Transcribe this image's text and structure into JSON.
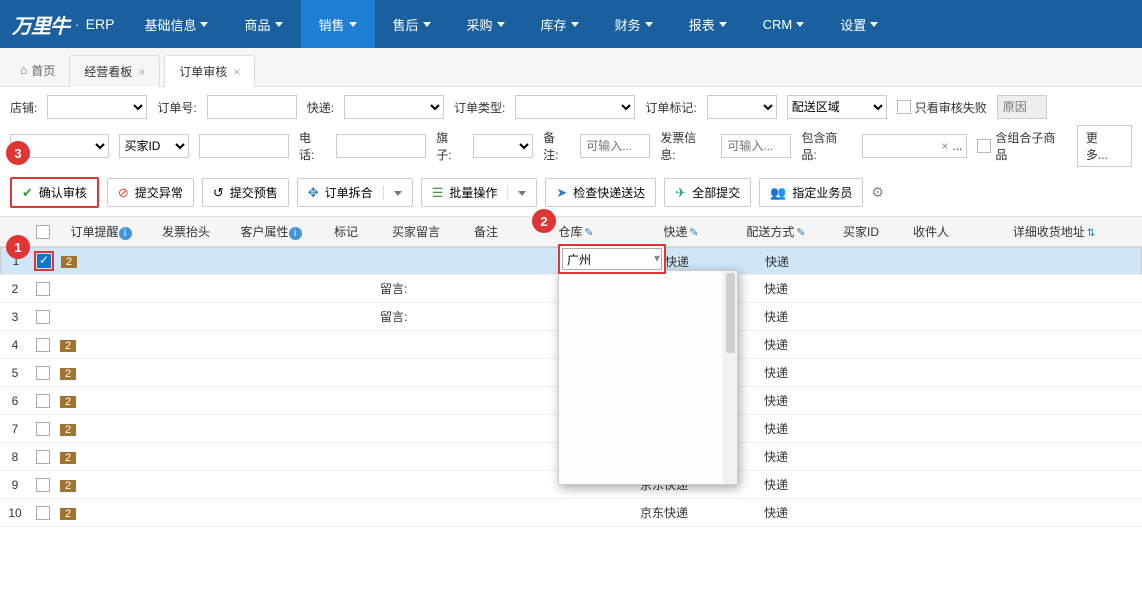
{
  "app": {
    "logo_text": "万里牛",
    "product": "ERP"
  },
  "nav": {
    "items": [
      {
        "label": "基础信息"
      },
      {
        "label": "商品"
      },
      {
        "label": "销售",
        "active": true
      },
      {
        "label": "售后"
      },
      {
        "label": "采购"
      },
      {
        "label": "库存"
      },
      {
        "label": "财务"
      },
      {
        "label": "报表"
      },
      {
        "label": "CRM"
      },
      {
        "label": "设置"
      }
    ]
  },
  "tabs": {
    "home": "首页",
    "items": [
      {
        "label": "经营看板"
      },
      {
        "label": "订单审核",
        "active": true
      }
    ]
  },
  "filters": {
    "row1": {
      "store": "店铺:",
      "order_no": "订单号:",
      "express": "快递:",
      "order_type": "订单类型:",
      "order_tag": "订单标记:",
      "delivery_area": "配送区域",
      "only_fail": "只看审核失败",
      "reason_placeholder": "原因"
    },
    "row2": {
      "buyer_id": "买家ID",
      "phone": "电话:",
      "flag": "旗子:",
      "note": "备注:",
      "note_ph": "可输入...",
      "invoice_info": "发票信息:",
      "invoice_ph": "可输入...",
      "include_goods": "包含商品:",
      "include_sub": "含组合子商品",
      "more": "更 多..."
    }
  },
  "toolbar": {
    "confirm": "确认审核",
    "exception": "提交异常",
    "presale": "提交预售",
    "split": "订单拆合",
    "batch": "批量操作",
    "check_express": "检查快递送达",
    "submit_all": "全部提交",
    "assign": "指定业务员"
  },
  "columns": {
    "order_remind": "订单提醒",
    "invoice_head": "发票抬头",
    "cust_attr": "客户属性",
    "mark": "标记",
    "buyer_msg": "买家留言",
    "note": "备注",
    "warehouse": "仓库",
    "express": "快递",
    "ship_method": "配送方式",
    "buyer_id": "买家ID",
    "receiver": "收件人",
    "address": "详细收货地址"
  },
  "rows": [
    {
      "n": "1",
      "checked": true,
      "badge": "2",
      "msg": "",
      "express": "京东快递",
      "ship": "快递"
    },
    {
      "n": "2",
      "checked": false,
      "badge": "",
      "msg": "留言:",
      "express": "",
      "ship": "快递"
    },
    {
      "n": "3",
      "checked": false,
      "badge": "",
      "msg": "留言:",
      "express": "",
      "ship": "快递"
    },
    {
      "n": "4",
      "checked": false,
      "badge": "2",
      "msg": "",
      "express": "",
      "ship": "快递"
    },
    {
      "n": "5",
      "checked": false,
      "badge": "2",
      "msg": "",
      "express": "",
      "ship": "快递"
    },
    {
      "n": "6",
      "checked": false,
      "badge": "2",
      "msg": "",
      "express": "",
      "ship": "快递"
    },
    {
      "n": "7",
      "checked": false,
      "badge": "2",
      "msg": "",
      "express": "",
      "ship": "快递"
    },
    {
      "n": "8",
      "checked": false,
      "badge": "2",
      "msg": "",
      "express": "",
      "ship": "快递"
    },
    {
      "n": "9",
      "checked": false,
      "badge": "2",
      "msg": "",
      "express": "京东快递",
      "ship": "快递"
    },
    {
      "n": "10",
      "checked": false,
      "badge": "2",
      "msg": "",
      "express": "京东快递",
      "ship": "快递"
    }
  ],
  "dropdown": {
    "value": "广州"
  },
  "annotations": {
    "a1": "1",
    "a2": "2",
    "a3": "3"
  },
  "misc": {
    "times_x": "×",
    "ellipsis": "..."
  }
}
